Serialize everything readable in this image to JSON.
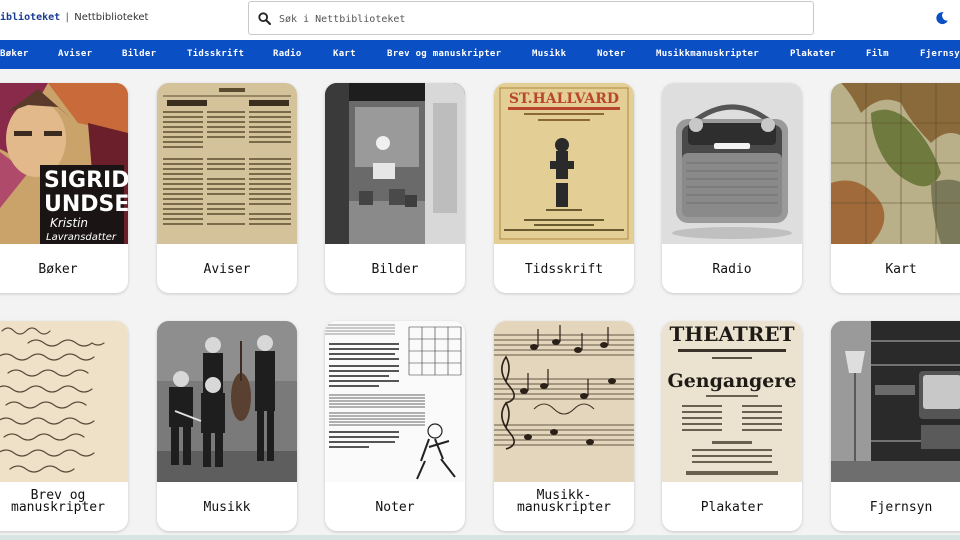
{
  "header": {
    "brand_bold": "iblioteket",
    "brand_sep": "|",
    "brand_name": "Nettbiblioteket",
    "search_placeholder": "Søk i Nettbiblioteket",
    "icons": {
      "search": "search-icon",
      "theme": "moon-icon"
    }
  },
  "nav": {
    "items": [
      {
        "label": "Bøker"
      },
      {
        "label": "Aviser"
      },
      {
        "label": "Bilder"
      },
      {
        "label": "Tidsskrift"
      },
      {
        "label": "Radio"
      },
      {
        "label": "Kart"
      },
      {
        "label": "Brev og manuskripter"
      },
      {
        "label": "Musikk"
      },
      {
        "label": "Noter"
      },
      {
        "label": "Musikkmanuskripter"
      },
      {
        "label": "Plakater"
      },
      {
        "label": "Film"
      },
      {
        "label": "Fjernsyn"
      }
    ]
  },
  "cards": [
    {
      "label": "Bøker",
      "image_text": [
        "SIGRID",
        "UNDSET",
        "Kristin",
        "Lavransdatter"
      ]
    },
    {
      "label": "Aviser",
      "image_text": []
    },
    {
      "label": "Bilder",
      "image_text": []
    },
    {
      "label": "Tidsskrift",
      "image_text": [
        "ST.HALLVARD"
      ]
    },
    {
      "label": "Radio",
      "image_text": []
    },
    {
      "label": "Kart",
      "image_text": []
    },
    {
      "label": "Brev og manuskripter",
      "line1": "Brev og",
      "line2": "manuskripter",
      "image_text": []
    },
    {
      "label": "Musikk",
      "image_text": []
    },
    {
      "label": "Noter",
      "image_text": []
    },
    {
      "label": "Musikkmanuskripter",
      "line1": "Musikk-",
      "line2": "manuskripter",
      "image_text": []
    },
    {
      "label": "Plakater",
      "image_text": [
        "THEATRET",
        "Gengangere"
      ]
    },
    {
      "label": "Fjernsyn",
      "image_text": []
    }
  ],
  "colors": {
    "nav_bg": "#0b4fc4",
    "page_bg": "#f3f3f3",
    "brand": "#1a3c8f"
  }
}
